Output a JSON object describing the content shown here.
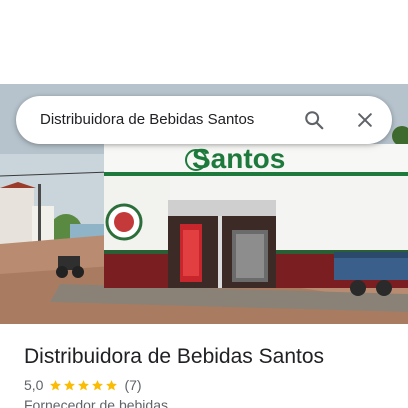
{
  "search": {
    "query": "Distribuidora de Bebidas Santos"
  },
  "photo": {
    "storefront_sign": "Santos"
  },
  "place": {
    "name": "Distribuidora de Bebidas Santos",
    "rating": "5,0",
    "stars": 5,
    "review_count": "(7)",
    "category": "Fornecedor de bebidas"
  },
  "colors": {
    "star": "#fbbc04",
    "sign_green": "#1e7a3c",
    "wall_red": "#7a1e22"
  },
  "icons": {
    "search": "search-icon",
    "clear": "close-icon",
    "star": "star-icon"
  }
}
